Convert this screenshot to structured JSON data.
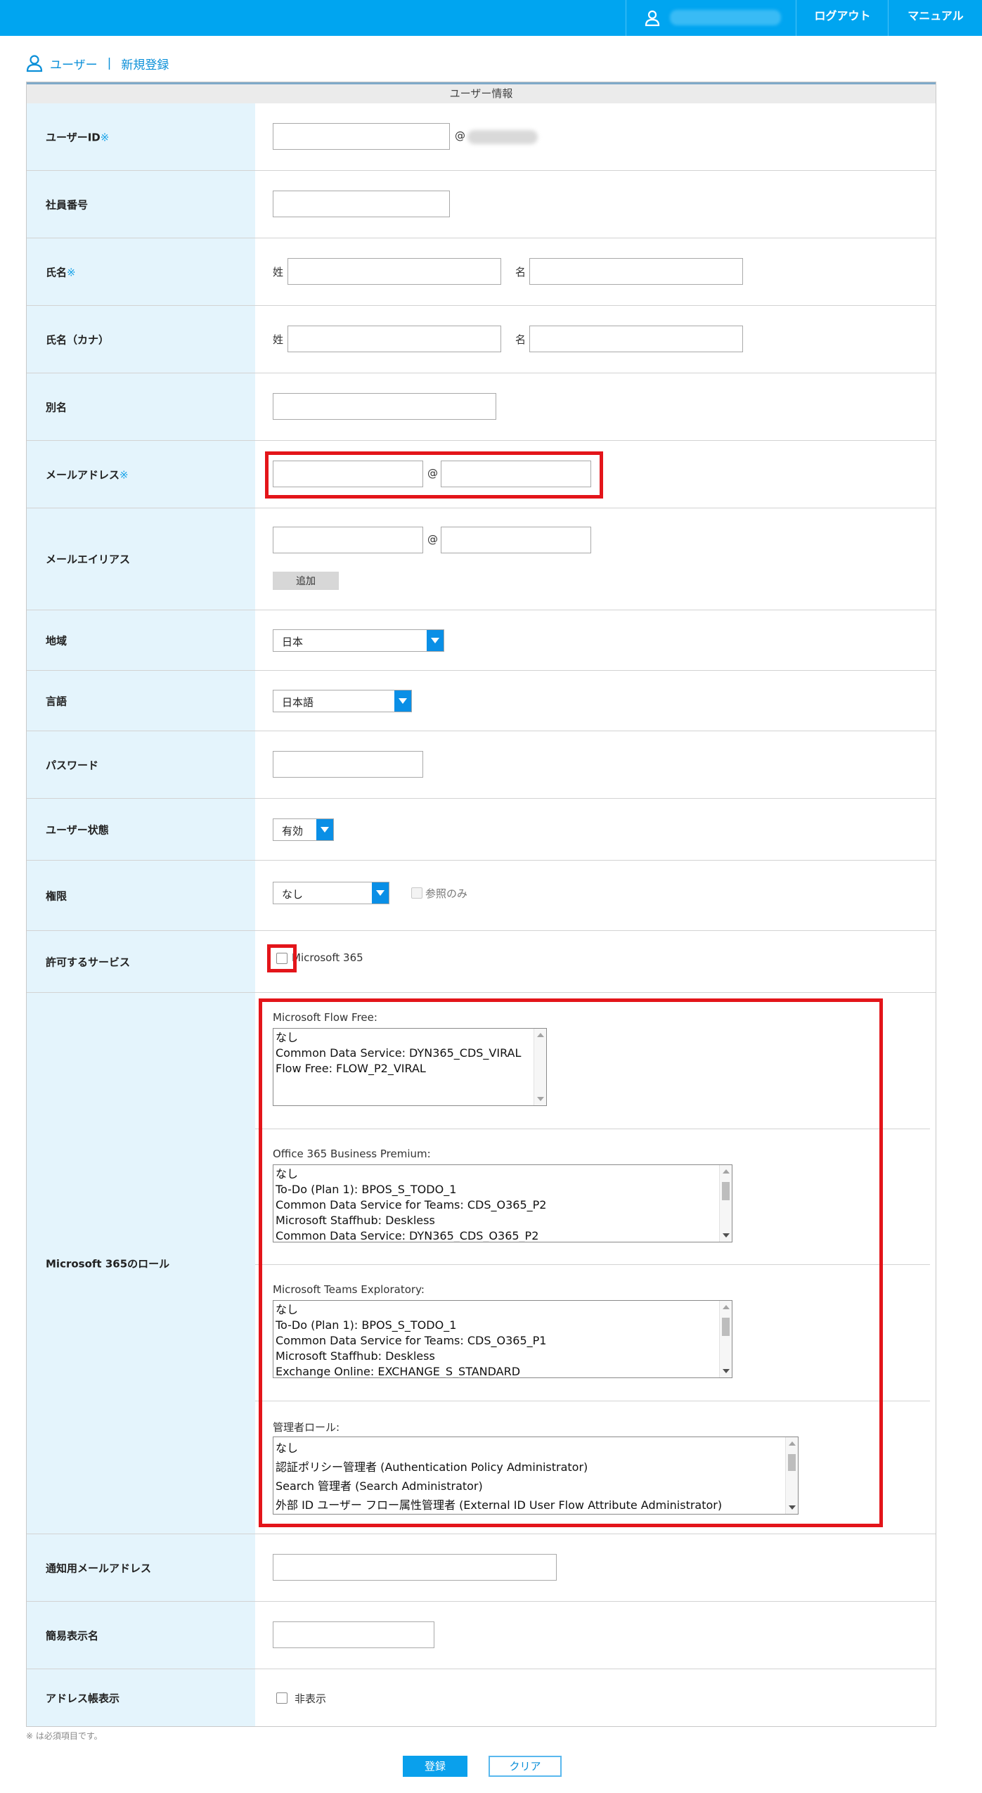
{
  "header": {
    "logout_label": "ログアウト",
    "manual_label": "マニュアル"
  },
  "breadcrumb": {
    "section": "ユーザー",
    "separator": "|",
    "page": "新規登録"
  },
  "table_title": "ユーザー情報",
  "required_mark": "※",
  "fields": {
    "user_id": {
      "label": "ユーザーID",
      "at": "@"
    },
    "employee_no": {
      "label": "社員番号"
    },
    "name": {
      "label": "氏名",
      "last": "姓",
      "first": "名"
    },
    "name_kana": {
      "label": "氏名（カナ）",
      "last": "姓",
      "first": "名"
    },
    "alias": {
      "label": "別名"
    },
    "email": {
      "label": "メールアドレス",
      "at": "@"
    },
    "email_alias": {
      "label": "メールエイリアス",
      "at": "@",
      "add_button": "追加"
    },
    "region": {
      "label": "地域",
      "value": "日本"
    },
    "language": {
      "label": "言語",
      "value": "日本語"
    },
    "password": {
      "label": "パスワード"
    },
    "user_status": {
      "label": "ユーザー状態",
      "value": "有効"
    },
    "permission": {
      "label": "権限",
      "value": "なし",
      "readonly_label": "参照のみ"
    },
    "services": {
      "label": "許可するサービス",
      "option": "Microsoft 365"
    },
    "roles": {
      "label": "Microsoft 365のロール",
      "groups": [
        {
          "title": "Microsoft Flow Free:",
          "items": [
            "なし",
            "Common Data Service: DYN365_CDS_VIRAL",
            "Flow Free: FLOW_P2_VIRAL"
          ]
        },
        {
          "title": "Office 365 Business Premium:",
          "items": [
            "なし",
            "To-Do (Plan 1): BPOS_S_TODO_1",
            "Common Data Service for Teams: CDS_O365_P2",
            "Microsoft Staffhub: Deskless",
            "Common Data Service: DYN365_CDS_O365_P2"
          ]
        },
        {
          "title": "Microsoft Teams Exploratory:",
          "items": [
            "なし",
            "To-Do (Plan 1): BPOS_S_TODO_1",
            "Common Data Service for Teams: CDS_O365_P1",
            "Microsoft Staffhub: Deskless",
            "Exchange Online: EXCHANGE_S_STANDARD"
          ]
        },
        {
          "title": "管理者ロール:",
          "items": [
            "なし",
            "認証ポリシー管理者 (Authentication Policy Administrator)",
            "Search 管理者 (Search Administrator)",
            "外部 ID ユーザー フロー属性管理者 (External ID User Flow Attribute Administrator)"
          ]
        }
      ]
    },
    "notify_email": {
      "label": "通知用メールアドレス"
    },
    "display_name": {
      "label": "簡易表示名"
    },
    "address_book": {
      "label": "アドレス帳表示",
      "option": "非表示"
    }
  },
  "footnote": "※ は必須項目です。",
  "buttons": {
    "register": "登録",
    "clear": "クリア"
  },
  "colors": {
    "header_bg": "#00a5f0",
    "label_bg": "#e4f4fc",
    "accent": "#0a8fe6",
    "highlight": "#e3151a"
  },
  "icons": [
    "user-icon",
    "dropdown-arrow-icon",
    "scroll-up-icon",
    "scroll-down-icon"
  ]
}
